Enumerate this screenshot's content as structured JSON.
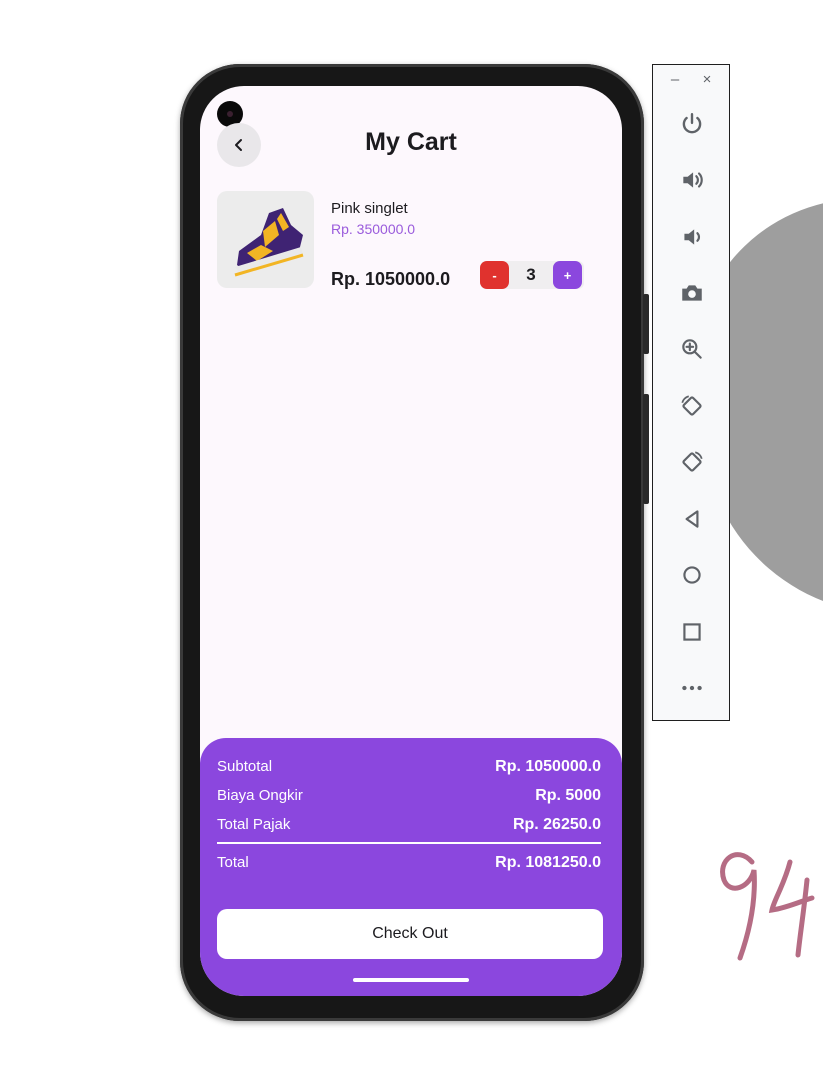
{
  "app": {
    "title": "My Cart"
  },
  "cart": {
    "items": [
      {
        "name": "Pink singlet",
        "unit_price": "Rp. 350000.0",
        "line_total": "Rp. 1050000.0",
        "quantity": "3",
        "minus_label": "-",
        "plus_label": "+"
      }
    ]
  },
  "summary": {
    "subtotal_label": "Subtotal",
    "subtotal_value": "Rp. 1050000.0",
    "shipping_label": "Biaya Ongkir",
    "shipping_value": "Rp. 5000",
    "tax_label": "Total Pajak",
    "tax_value": "Rp. 26250.0",
    "total_label": "Total",
    "total_value": "Rp. 1081250.0",
    "checkout_label": "Check Out"
  },
  "emulator_toolbar": {
    "window_controls": {
      "minimize": "–",
      "close": "×"
    },
    "buttons": [
      "power-icon",
      "volume-up-icon",
      "volume-down-icon",
      "camera-icon",
      "zoom-icon",
      "rotate-left-icon",
      "rotate-right-icon",
      "back-icon",
      "home-icon",
      "overview-icon",
      "more-icon"
    ]
  },
  "colors": {
    "accent": "#8b47de",
    "minus": "#e0322e",
    "price_text": "#9a5bdc",
    "screen_bg": "#fdf8fd"
  }
}
